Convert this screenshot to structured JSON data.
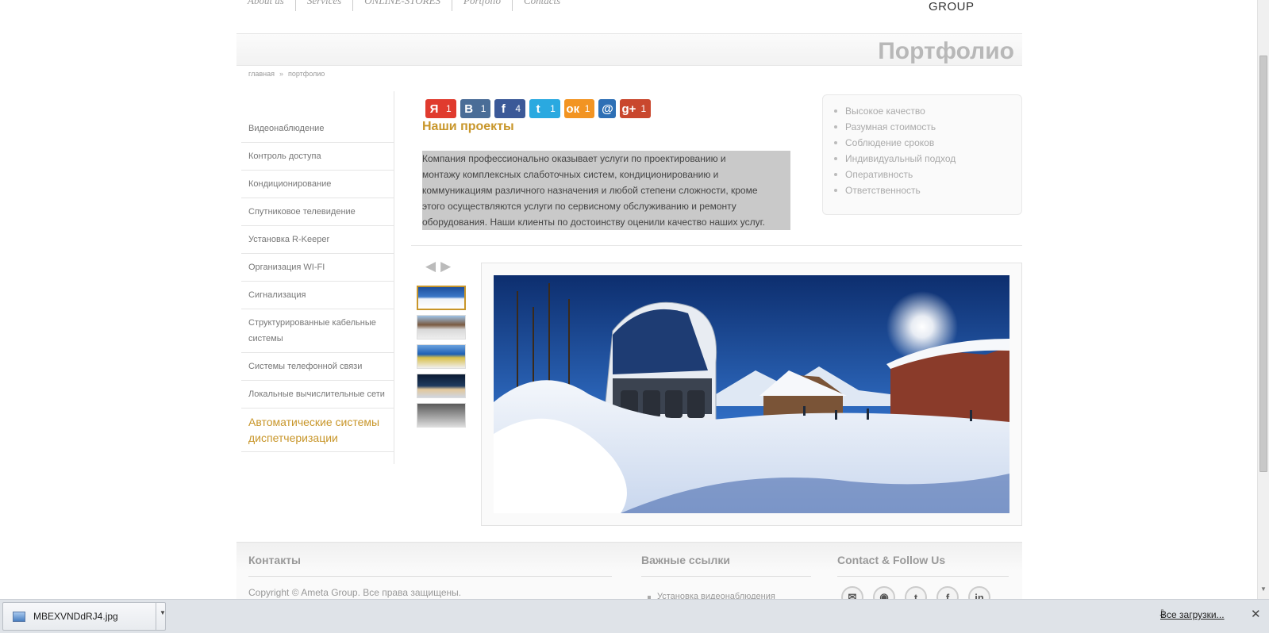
{
  "topnav": [
    "About us",
    "Services",
    "ONLINE-STORES",
    "Portfolio",
    "Contacts"
  ],
  "logo_text": "GROUP",
  "page_title": "Портфолио",
  "breadcrumb": {
    "home": "главная",
    "sep": "»",
    "current": "портфолио"
  },
  "sidebar": {
    "items": [
      "Видеонаблюдение",
      "Контроль доступа",
      "Кондиционирование",
      "Спутниковое телевидение",
      "Установка R-Keeper",
      "Организация WI-FI",
      "Сигнализация",
      "Структурированные кабельные системы",
      "Системы телефонной связи",
      "Локальные вычислительные сети",
      "Автоматические системы диспетчеризации"
    ],
    "active_index": 10
  },
  "social": [
    {
      "icon": "yandex-icon",
      "glyph": "Я",
      "count": "1",
      "color": "#e03b2e"
    },
    {
      "icon": "vk-icon",
      "glyph": "В",
      "count": "1",
      "color": "#4a6d97"
    },
    {
      "icon": "facebook-icon",
      "glyph": "f",
      "count": "4",
      "color": "#3b5998"
    },
    {
      "icon": "twitter-icon",
      "glyph": "t",
      "count": "1",
      "color": "#2aa9e0"
    },
    {
      "icon": "odnoklassniki-icon",
      "glyph": "ок",
      "count": "1",
      "color": "#f29422"
    },
    {
      "icon": "mailru-icon",
      "glyph": "@",
      "count": "",
      "color": "#2d6fb5"
    },
    {
      "icon": "googleplus-icon",
      "glyph": "g+",
      "count": "1",
      "color": "#c9472e"
    }
  ],
  "section_title": "Наши проекты",
  "intro_lines": [
    "Компания профессионально оказывает услуги по проектированию и",
    "монтажу комплексных слаботочных систем, кондиционированию и",
    "коммуникациям различного назначения и любой степени сложности, кроме",
    "этого осуществляются услуги по сервисному обслуживанию и ремонту",
    "оборудования. Наши клиенты по достоинству оценили качество наших услуг."
  ],
  "features": [
    "Высокое качество",
    "Разумная стоимость",
    "Соблюдение сроков",
    "Индивидуальный подход",
    "Оперативность",
    "Ответственность"
  ],
  "gallery": {
    "prev": "◀",
    "next": "▶",
    "selected_thumb": 0
  },
  "footer": {
    "contacts_title": "Контакты",
    "copyright": "Copyright © Ameta Group. Все права защищены.",
    "links_title": "Важные ссылки",
    "link_1": "Установка видеонаблюдения",
    "follow_title": "Contact & Follow Us",
    "follow_icons": [
      {
        "name": "email-icon",
        "glyph": "✉"
      },
      {
        "name": "rss-icon",
        "glyph": "◉"
      },
      {
        "name": "twitter-icon",
        "glyph": "t"
      },
      {
        "name": "facebook-icon",
        "glyph": "f"
      },
      {
        "name": "linkedin-icon",
        "glyph": "in"
      }
    ]
  },
  "download": {
    "filename": "MBEXVNDdRJ4.jpg",
    "all": "Все загрузки...",
    "close": "✕"
  }
}
